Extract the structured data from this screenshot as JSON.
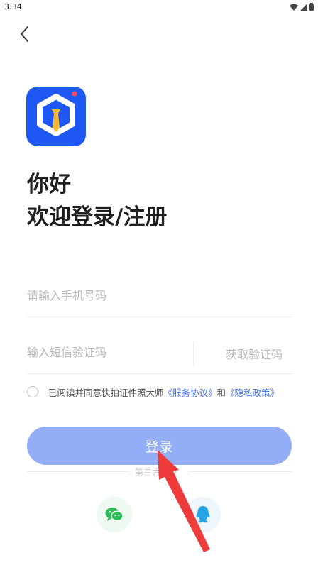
{
  "status_bar": {
    "time": "3:34"
  },
  "heading": {
    "greeting": "你好",
    "welcome": "欢迎登录/注册"
  },
  "form": {
    "phone_placeholder": "请输入手机号码",
    "code_placeholder": "输入短信验证码",
    "get_code_label": "获取验证码"
  },
  "agreement": {
    "text": "已阅读并同意快拍证件照大师",
    "service_link": "《服务协议》",
    "conjunction": "和",
    "privacy_link": "《隐私政策》"
  },
  "login_button": {
    "label": "登录"
  },
  "third_party": {
    "label": "第三方登录"
  },
  "colors": {
    "brand_blue": "#1f57f5",
    "button": "#93adf7",
    "link": "#3d6ef7",
    "arrow": "#ee3b3b"
  },
  "icons": {
    "wechat": "wechat-icon",
    "qq": "qq-icon"
  }
}
